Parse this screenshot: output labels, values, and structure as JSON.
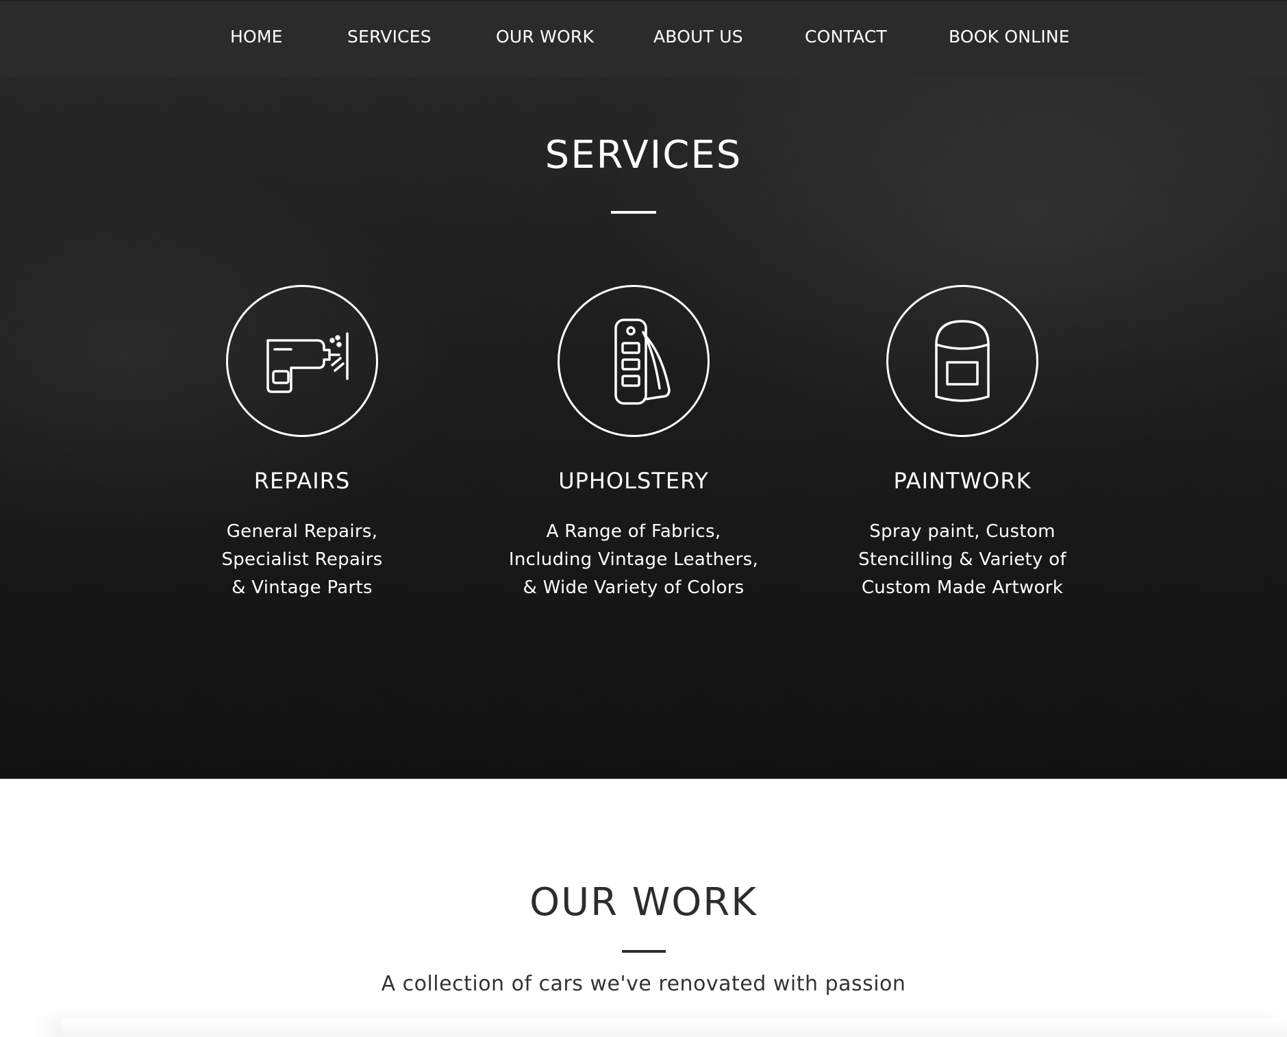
{
  "nav": {
    "items": [
      {
        "label": "HOME"
      },
      {
        "label": "SERVICES"
      },
      {
        "label": "OUR WORK"
      },
      {
        "label": "ABOUT US"
      },
      {
        "label": "CONTACT"
      },
      {
        "label": "BOOK ONLINE"
      }
    ]
  },
  "services": {
    "title": "SERVICES",
    "cards": [
      {
        "icon": "spray-gun-icon",
        "heading": "REPAIRS",
        "lines": [
          "General Repairs,",
          "Specialist Repairs",
          "& Vintage Parts"
        ]
      },
      {
        "icon": "fabric-swatch-icon",
        "heading": "UPHOLSTERY",
        "lines": [
          "A Range of Fabrics,",
          "Including Vintage Leathers,",
          "& Wide Variety of Colors"
        ]
      },
      {
        "icon": "paint-bucket-icon",
        "heading": "PAINTWORK",
        "lines": [
          "Spray paint, Custom",
          "Stencilling & Variety of",
          "Custom Made Artwork"
        ]
      }
    ]
  },
  "work": {
    "title": "OUR WORK",
    "subtitle": "A collection of cars we've renovated with passion"
  },
  "colors": {
    "nav_bg": "#2b2b2b",
    "hero_bg": "#1c1c1c",
    "text_light": "#ffffff",
    "text_dark": "#2d2d2d"
  }
}
